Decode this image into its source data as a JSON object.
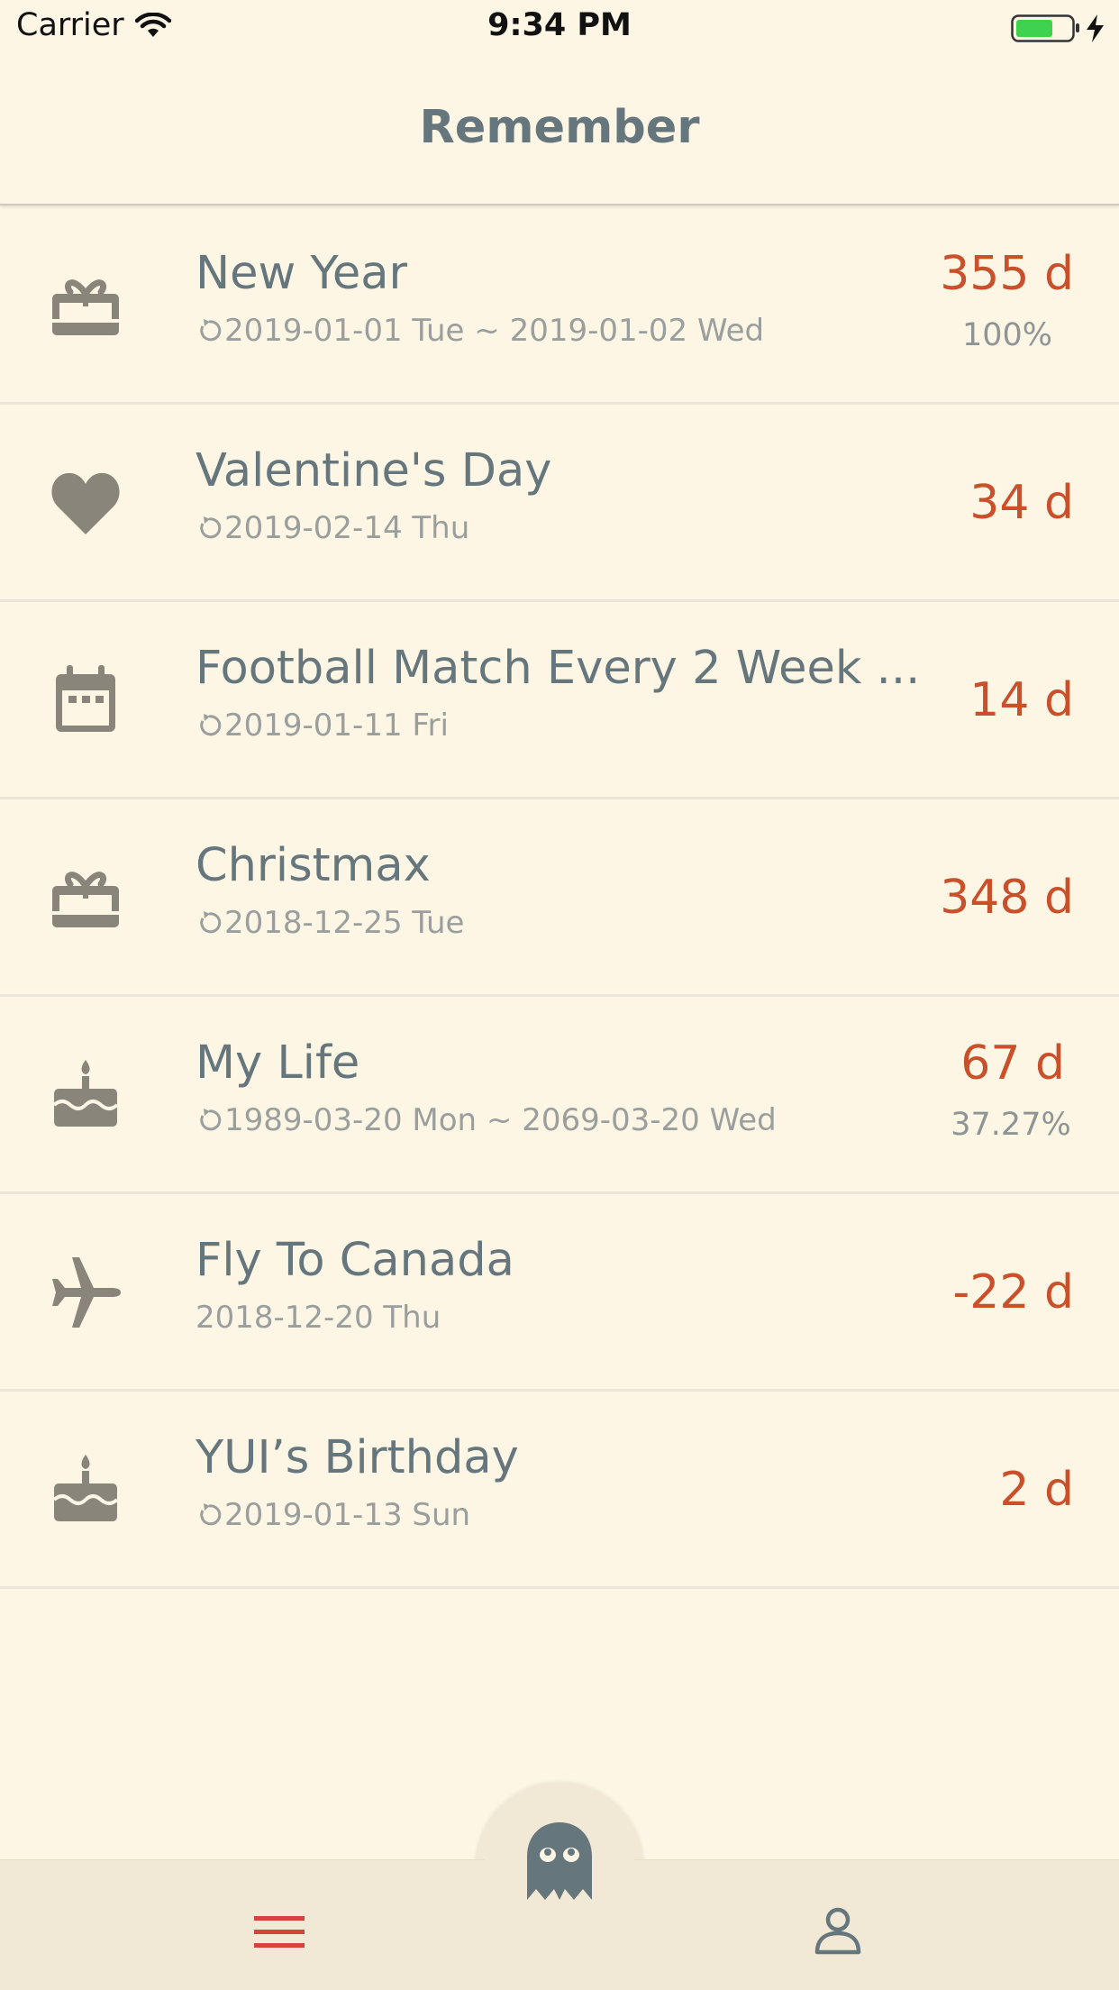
{
  "status_bar": {
    "carrier": "Carrier",
    "time": "9:34 PM"
  },
  "nav": {
    "title": "Remember"
  },
  "colors": {
    "accent": "#c9502a",
    "text": "#66767d",
    "muted": "#9a9e9c",
    "icon": "#8a857a",
    "background": "#fdf6e5",
    "tab_active": "#d8423d"
  },
  "events": [
    {
      "icon": "gift-icon",
      "title": "New Year",
      "repeat": true,
      "dates": "2019-01-01 Tue ~ 2019-01-02 Wed",
      "days": "355 d",
      "progress": "100%"
    },
    {
      "icon": "heart-icon",
      "title": "Valentine's Day",
      "repeat": true,
      "dates": "2019-02-14 Thu",
      "days": "34 d"
    },
    {
      "icon": "calendar-icon",
      "title": "Football Match Every 2 Week ...",
      "repeat": true,
      "dates": "2019-01-11 Fri",
      "days": "14 d"
    },
    {
      "icon": "gift-icon",
      "title": "Christmax",
      "repeat": true,
      "dates": "2018-12-25 Tue",
      "days": "348 d"
    },
    {
      "icon": "cake-icon",
      "title": "My Life",
      "repeat": true,
      "dates": "1989-03-20 Mon ~ 2069-03-20 Wed",
      "days": "67 d",
      "progress": "37.27%"
    },
    {
      "icon": "airplane-icon",
      "title": "Fly To Canada",
      "repeat": false,
      "dates": "2018-12-20 Thu",
      "days": "-22 d"
    },
    {
      "icon": "cake-icon",
      "title": "YUI’s Birthday",
      "repeat": true,
      "dates": "2019-01-13 Sun",
      "days": "2 d"
    }
  ],
  "tabs": [
    {
      "icon": "list-icon",
      "active": true
    },
    {
      "icon": "ghost-icon",
      "center": true
    },
    {
      "icon": "person-icon",
      "active": false
    }
  ]
}
